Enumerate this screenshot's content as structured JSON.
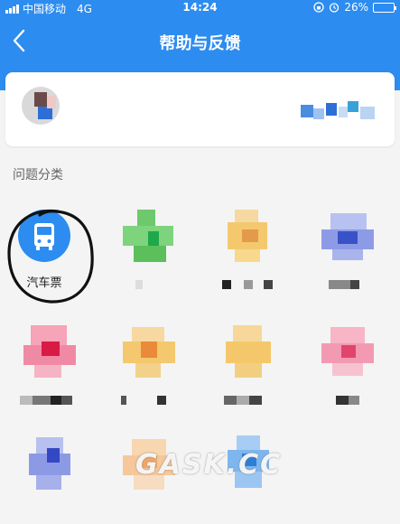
{
  "status_bar": {
    "carrier": "中国移动",
    "network": "4G",
    "time": "14:24",
    "battery": "26%",
    "battery_level": 0.26
  },
  "nav": {
    "title": "帮助与反馈",
    "back_icon": "chevron-left-icon"
  },
  "section": {
    "title": "问题分类"
  },
  "categories": [
    {
      "label": "汽车票",
      "icon": "bus-icon",
      "color": "#2d8cf0"
    }
  ],
  "watermark": "GASK.CC",
  "colors": {
    "brand": "#2d8cf0",
    "background": "#f4f4f4",
    "annotation": "#111111"
  }
}
